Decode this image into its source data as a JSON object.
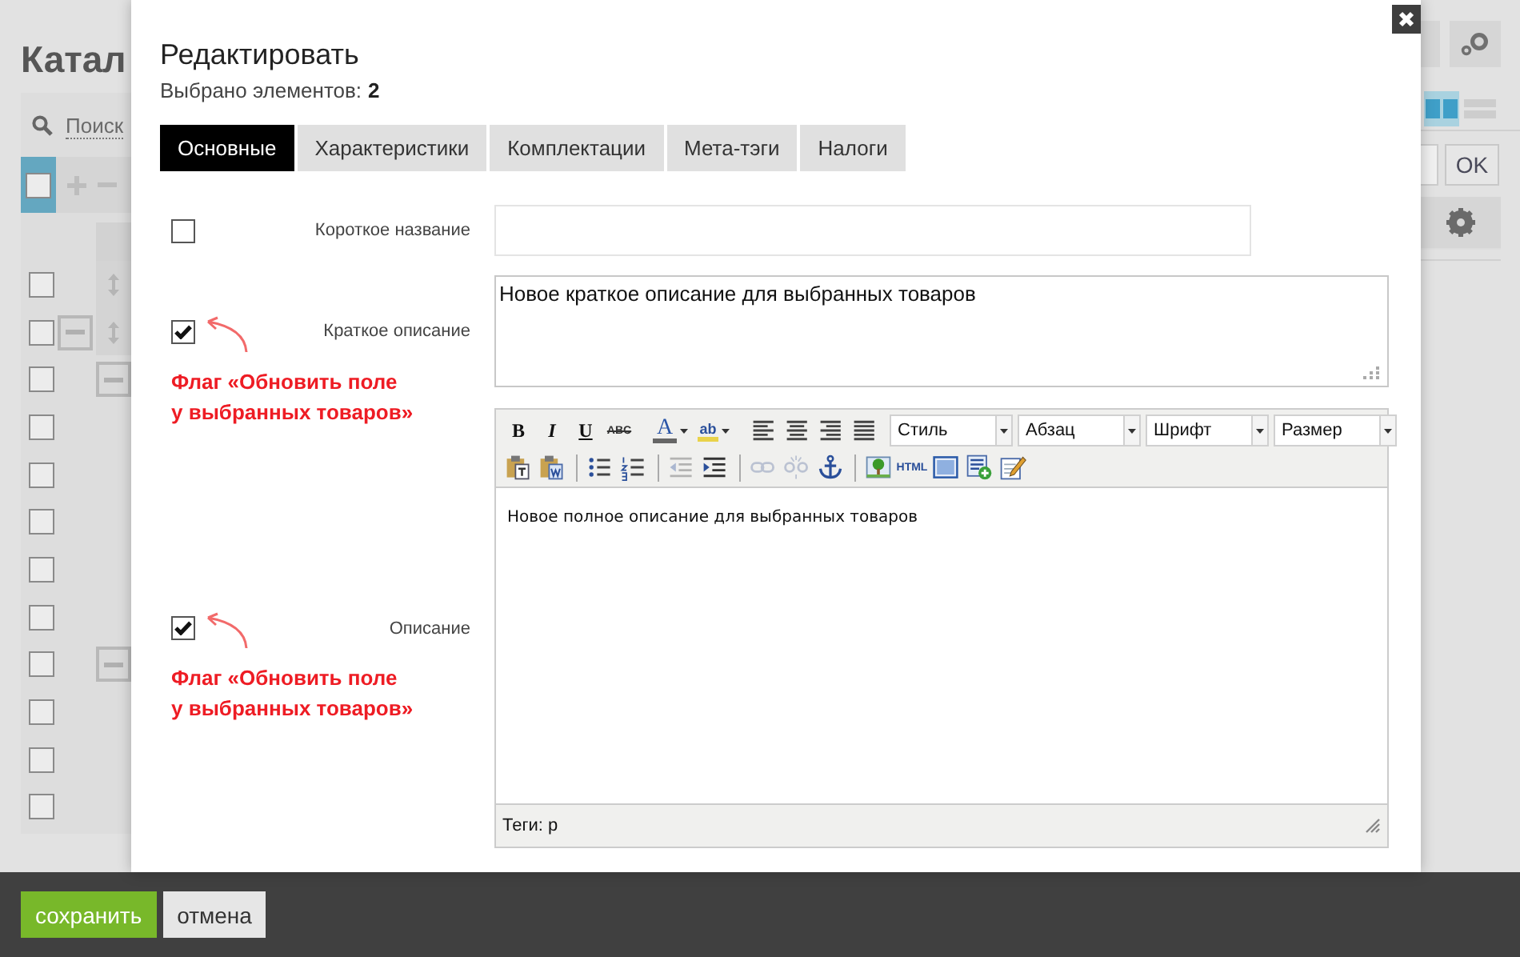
{
  "background_page": {
    "title": "Катал",
    "search_link": "Поиск",
    "select_all": {
      "checked": false
    },
    "rows": [
      {
        "kind": "sortable",
        "checked": false
      },
      {
        "kind": "group",
        "checked": false
      },
      {
        "kind": "subgroup",
        "checked": false
      },
      {
        "kind": "plain",
        "checked": false
      },
      {
        "kind": "plain",
        "checked": false
      },
      {
        "kind": "plain",
        "checked": false
      },
      {
        "kind": "plain",
        "checked": false
      },
      {
        "kind": "plain",
        "checked": false
      },
      {
        "kind": "subgroup",
        "checked": false
      },
      {
        "kind": "plain",
        "checked": false
      },
      {
        "kind": "plain",
        "checked": false
      },
      {
        "kind": "plain",
        "checked": false
      }
    ],
    "view_modes": [
      {
        "kind": "grid",
        "selected": true
      },
      {
        "kind": "list",
        "selected": false
      }
    ],
    "ok_button": "OK"
  },
  "dialog": {
    "title": "Редактировать",
    "selected_count_label": "Выбрано элементов:",
    "selected_count": "2",
    "tabs": [
      {
        "label": "Основные",
        "selected": true
      },
      {
        "label": "Характеристики",
        "selected": false
      },
      {
        "label": "Комплектации",
        "selected": false
      },
      {
        "label": "Мета-тэги",
        "selected": false
      },
      {
        "label": "Налоги",
        "selected": false
      }
    ],
    "fields": [
      {
        "kind": "input",
        "label": "Короткое название",
        "checked": false
      },
      {
        "kind": "textarea",
        "label": "Краткое описание",
        "checked": true,
        "value": "Новое краткое описание для выбранных товаров",
        "annotation": "Флаг «Обновить поле\nу выбранных товаров»"
      },
      {
        "kind": "editor",
        "label": "Описание",
        "checked": true,
        "value": "Новое полное описание для выбранных товаров",
        "annotation": "Флаг «Обновить поле\nу выбранных товаров»",
        "status": "Теги: p",
        "toolbar": [
          {
            "groups": [
              [
                {
                  "kind": "bold",
                  "label": "B",
                  "disabled": false
                },
                {
                  "kind": "italic",
                  "label": "I",
                  "disabled": false
                },
                {
                  "kind": "underline",
                  "label": "U",
                  "disabled": false
                },
                {
                  "kind": "strike",
                  "label": "ABC",
                  "disabled": false
                }
              ],
              [
                {
                  "kind": "text-color",
                  "label": "A",
                  "disabled": false
                },
                {
                  "kind": "highlight",
                  "label": "ab",
                  "disabled": false
                }
              ],
              [
                {
                  "kind": "align-left",
                  "disabled": false
                },
                {
                  "kind": "align-center",
                  "disabled": false
                },
                {
                  "kind": "align-right",
                  "disabled": false
                },
                {
                  "kind": "align-justify",
                  "disabled": false
                }
              ]
            ],
            "selects": [
              "Стиль",
              "Абзац",
              "Шрифт",
              "Размер"
            ]
          },
          {
            "groups": [
              [
                {
                  "kind": "paste-text",
                  "disabled": false
                },
                {
                  "kind": "paste-word",
                  "disabled": false
                }
              ],
              [
                {
                  "kind": "bullet-list",
                  "disabled": false
                },
                {
                  "kind": "numbered-list",
                  "disabled": false
                }
              ],
              [
                {
                  "kind": "outdent",
                  "disabled": true
                },
                {
                  "kind": "indent",
                  "disabled": false
                }
              ],
              [
                {
                  "kind": "link",
                  "disabled": true
                },
                {
                  "kind": "unlink",
                  "disabled": true
                },
                {
                  "kind": "anchor",
                  "disabled": false
                }
              ],
              [
                {
                  "kind": "image",
                  "disabled": false
                },
                {
                  "kind": "html",
                  "label": "HTML",
                  "disabled": false
                },
                {
                  "kind": "block",
                  "disabled": false
                },
                {
                  "kind": "insert-image",
                  "disabled": false
                },
                {
                  "kind": "edit",
                  "disabled": false
                }
              ]
            ]
          }
        ]
      }
    ]
  },
  "footer_buttons": [
    {
      "kind": "primary",
      "label": "сохранить"
    },
    {
      "kind": "secondary",
      "label": "отмена"
    }
  ]
}
